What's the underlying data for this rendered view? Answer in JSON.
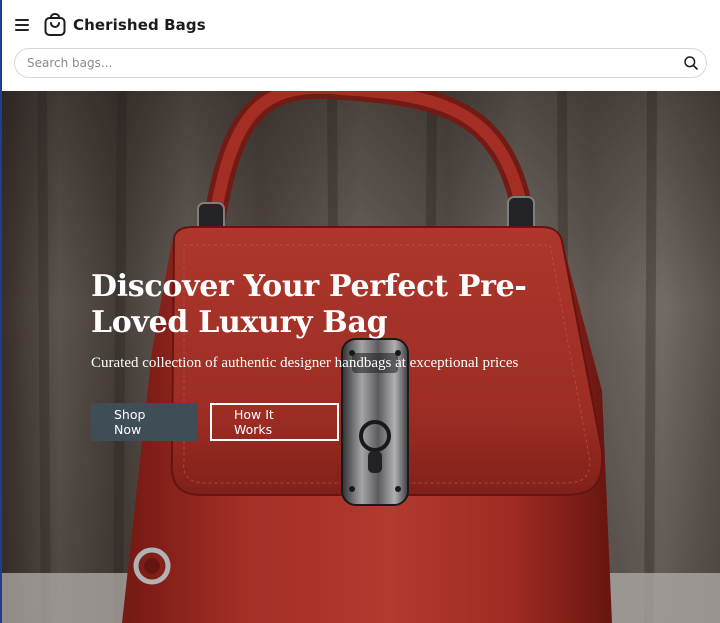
{
  "header": {
    "brand": "Cherished Bags"
  },
  "search": {
    "placeholder": "Search bags..."
  },
  "hero": {
    "title": "Discover Your Perfect Pre-Loved Luxury Bag",
    "subtitle": "Curated collection of authentic designer handbags at exceptional prices",
    "primary_button": "Shop Now",
    "secondary_button": "How It Works"
  },
  "colors": {
    "primary_button_bg": "#3f4d57",
    "bag_red": "#c7352b",
    "border_accent": "#1d3f8f"
  },
  "icons": {
    "menu": "hamburger-menu-icon",
    "logo": "shopping-bag-icon",
    "search": "search-icon"
  }
}
